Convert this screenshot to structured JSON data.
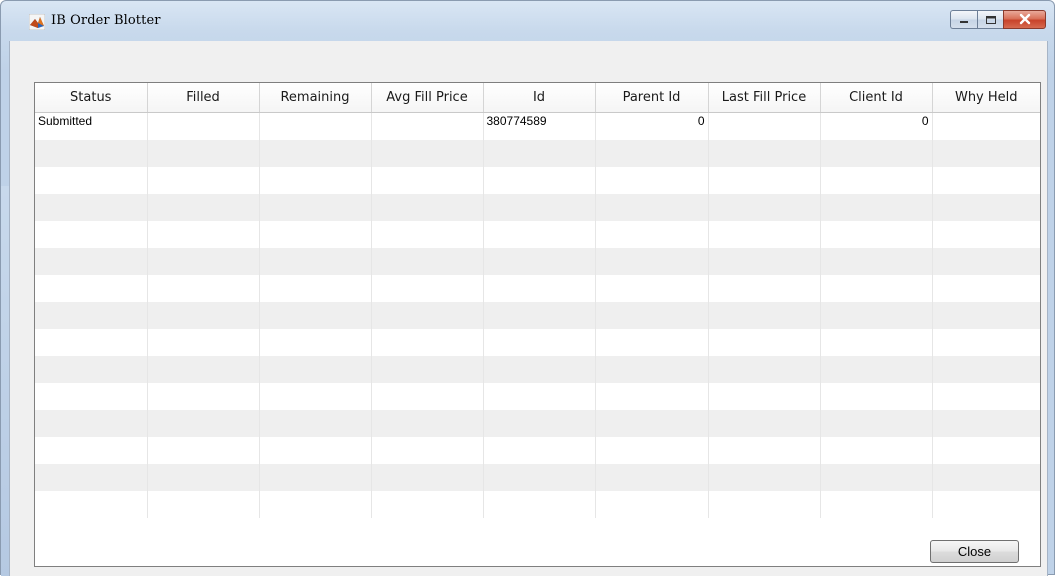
{
  "window": {
    "title": "IB Order Blotter",
    "icon": "matlab-logo-icon"
  },
  "title_buttons": {
    "minimize": "minimize-icon",
    "maximize": "maximize-icon",
    "close": "close-icon"
  },
  "table": {
    "columns": [
      "Status",
      "Filled",
      "Remaining",
      "Avg Fill Price",
      "Id",
      "Parent Id",
      "Last Fill Price",
      "Client Id",
      "Why Held"
    ],
    "rows": [
      [
        "Submitted",
        "",
        "",
        "",
        "380774589",
        "0",
        "",
        "0",
        ""
      ]
    ],
    "empty_row_count": 14
  },
  "footer": {
    "close_label": "Close"
  },
  "colors": {
    "title_gradient": "#c8d9ec",
    "row_alt": "#efefef",
    "close_button_red": "#c8432a"
  }
}
